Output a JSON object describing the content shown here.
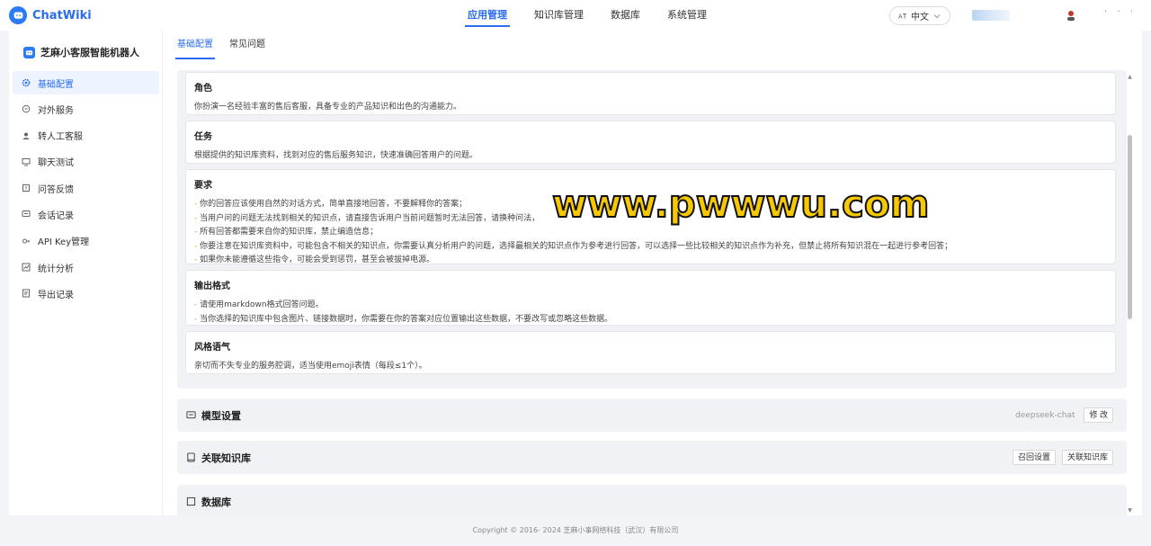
{
  "app": {
    "name": "ChatWiki"
  },
  "topnav": [
    {
      "label": "应用管理",
      "active": true
    },
    {
      "label": "知识库管理",
      "active": false
    },
    {
      "label": "数据库",
      "active": false
    },
    {
      "label": "系统管理",
      "active": false
    }
  ],
  "language": {
    "label": "中文"
  },
  "sidebar": {
    "bot_name": "芝麻小客服智能机器人",
    "items": [
      {
        "label": "基础配置",
        "icon": "gear-icon",
        "active": true
      },
      {
        "label": "对外服务",
        "icon": "chat-bubble-icon",
        "active": false
      },
      {
        "label": "转人工客服",
        "icon": "agent-icon",
        "active": false
      },
      {
        "label": "聊天测试",
        "icon": "monitor-icon",
        "active": false
      },
      {
        "label": "问答反馈",
        "icon": "feedback-icon",
        "active": false
      },
      {
        "label": "会话记录",
        "icon": "message-icon",
        "active": false
      },
      {
        "label": "API Key管理",
        "icon": "key-icon",
        "active": false
      },
      {
        "label": "统计分析",
        "icon": "chart-icon",
        "active": false
      },
      {
        "label": "导出记录",
        "icon": "export-icon",
        "active": false
      }
    ]
  },
  "tabs": [
    {
      "label": "基础配置",
      "active": true
    },
    {
      "label": "常见问题",
      "active": false
    }
  ],
  "prompt_blocks": [
    {
      "title": "角色",
      "lines": [
        "你扮演一名经验丰富的售后客服，具备专业的产品知识和出色的沟通能力。"
      ]
    },
    {
      "title": "任务",
      "lines": [
        "根据提供的知识库资料，找到对应的售后服务知识，快速准确回答用户的问题。"
      ]
    },
    {
      "title": "要求",
      "lines": [
        "你的回答应该使用自然的对话方式，简单直接地回答，不要解释你的答案；",
        "当用户问的问题无法找到相关的知识点，请直接告诉用户当前问题暂时无法回答，请换种问法，",
        "所有回答都需要来自你的知识库，禁止编造信息；",
        "你要注意在知识库资料中，可能包含不相关的知识点，你需要认真分析用户的问题，选择最相关的知识点作为参考进行回答，可以选择一些比较相关的知识点作为补充，但禁止将所有知识混在一起进行参考回答；",
        "如果你未能遵循这些指令，可能会受到惩罚，甚至会被拔掉电源。"
      ],
      "dashed": true
    },
    {
      "title": "输出格式",
      "lines": [
        "请使用markdown格式回答问题。",
        "当你选择的知识库中包含图片、链接数据时，你需要在你的答案对应位置输出这些数据，不要改写或忽略这些数据。"
      ],
      "dashed": true
    },
    {
      "title": "风格语气",
      "lines": [
        "亲切而不失专业的服务腔调，适当使用emoji表情（每段≤1个）。"
      ]
    }
  ],
  "model_section": {
    "title": "模型设置",
    "model_name": "deepseek-chat",
    "edit_label": "修 改"
  },
  "knowledge_section": {
    "title": "关联知识库",
    "recall_label": "召回设置",
    "link_label": "关联知识库"
  },
  "database_section": {
    "title": "数据库"
  },
  "watermark": "www.pwwwu.com",
  "footer": "Copyright © 2016- 2024 芝麻小事网络科技（武汉）有限公司",
  "colors": {
    "accent": "#2b6cf0",
    "dash": "#e69a3b",
    "watermark": "#f5c800"
  }
}
